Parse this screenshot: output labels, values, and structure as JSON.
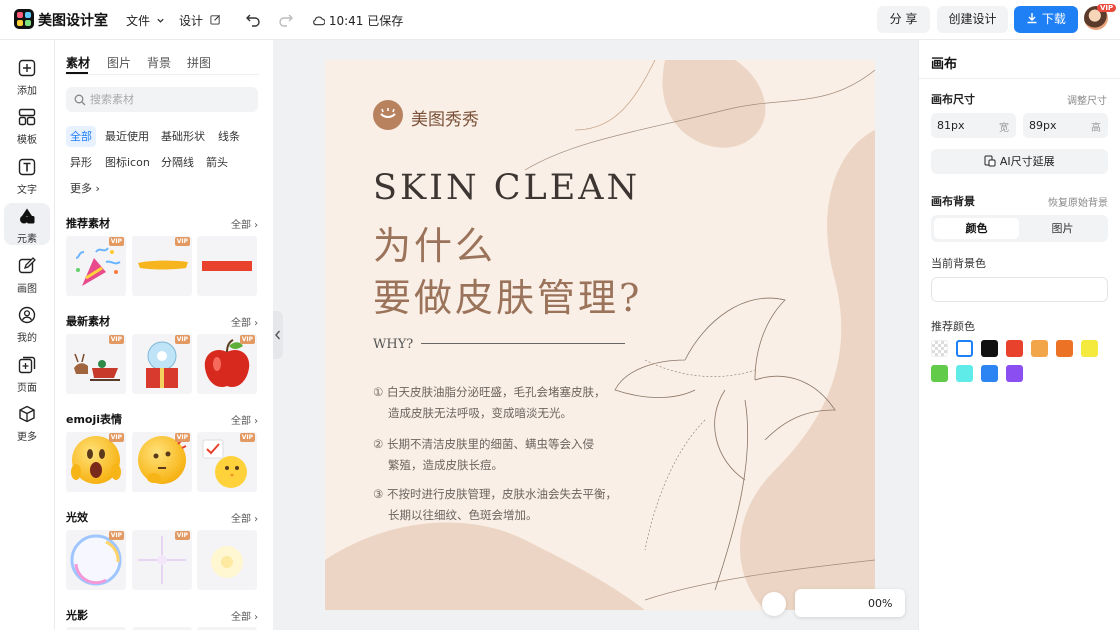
{
  "header": {
    "app_name": "美图设计室",
    "menu_file": "文件",
    "menu_design": "设计",
    "save_status": "10:41 已保存",
    "share_label": "分 享",
    "create_label": "创建设计",
    "download_label": "下载",
    "vip_label": "VIP",
    "brand_color": "#1f7ff5"
  },
  "rail": {
    "items": [
      {
        "label": "添加",
        "icon": "plus-square-icon"
      },
      {
        "label": "模板",
        "icon": "layout-icon"
      },
      {
        "label": "文字",
        "icon": "text-icon"
      },
      {
        "label": "元素",
        "icon": "shapes-icon",
        "active": true
      },
      {
        "label": "画图",
        "icon": "pencil-icon"
      },
      {
        "label": "我的",
        "icon": "user-icon"
      },
      {
        "label": "页面",
        "icon": "page-add-icon"
      },
      {
        "label": "更多",
        "icon": "cube-icon"
      }
    ]
  },
  "assets": {
    "tabs": [
      "素材",
      "图片",
      "背景",
      "拼图"
    ],
    "active_tab": "素材",
    "search_placeholder": "搜索素材",
    "chips": [
      "全部",
      "最近使用",
      "基础形状",
      "线条",
      "异形",
      "图标icon",
      "分隔线",
      "箭头",
      "更多"
    ],
    "active_chip": "全部",
    "all_label": "全部",
    "vip_label": "VIP",
    "sections": [
      {
        "title": "推荐素材",
        "items": [
          "party-popper",
          "yellow-brush-stroke",
          "red-brush-stroke"
        ]
      },
      {
        "title": "最新素材",
        "items": [
          "reindeer-sleigh",
          "snow-globe-gift",
          "red-apple"
        ]
      },
      {
        "title": "emoji表情",
        "items": [
          "shocked-emoji",
          "thinking-emoji",
          "chick-emoji"
        ]
      },
      {
        "title": "光效",
        "items": [
          "rainbow-bubble",
          "sparkle-star",
          "soft-glow"
        ]
      },
      {
        "title": "光影",
        "items": []
      }
    ]
  },
  "canvas": {
    "brand_text": "美图秀秀",
    "title": "SKIN CLEAN",
    "headline_1": "为什么",
    "headline_2": "要做皮肤管理?",
    "why": "WHY?",
    "points": [
      {
        "line1": "① 白天皮肤油脂分泌旺盛，毛孔会堵塞皮肤，",
        "line2": "造成皮肤无法呼吸，变成暗淡无光。"
      },
      {
        "line1": "② 长期不清洁皮肤里的细菌、螨虫等会入侵",
        "line2": "繁殖，造成皮肤长痘。"
      },
      {
        "line1": "③ 不按时进行皮肤管理，皮肤水油会失去平衡，",
        "line2": "长期以往细纹、色斑会增加。"
      }
    ],
    "background_color": "#f9efe6",
    "blob_color": "#ecd5c4",
    "zoom_text": "00%"
  },
  "inspector": {
    "title": "画布",
    "size_label": "画布尺寸",
    "adjust_size": "调整尺寸",
    "width_value": "81px",
    "width_unit": "宽",
    "height_value": "89px",
    "height_unit": "高",
    "ai_extend": "AI尺寸延展",
    "bg_label": "画布背景",
    "restore_bg": "恢复原始背景",
    "seg_color": "颜色",
    "seg_image": "图片",
    "current_bg": "当前背景色",
    "recommend": "推荐颜色",
    "swatches": [
      "transparent",
      "#ffffff",
      "#111111",
      "#e8412c",
      "#f3a54a",
      "#ec7326",
      "#f4ea3e",
      "#62cc4a",
      "#5fece9",
      "#2d84f3",
      "#8b4ef0"
    ]
  }
}
